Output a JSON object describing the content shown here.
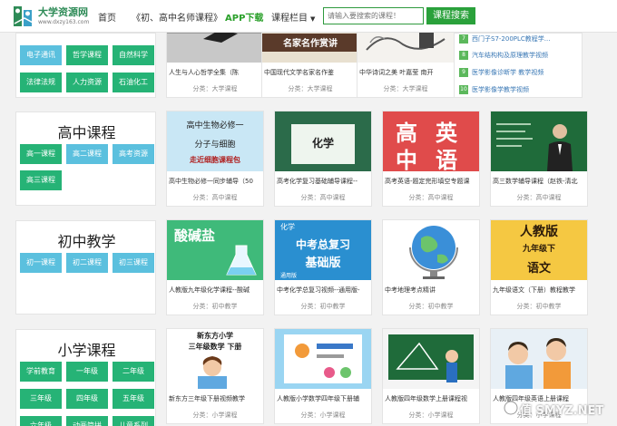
{
  "header": {
    "logo_title": "大学资源网",
    "logo_sub": "www.dxzy163.com",
    "nav": [
      "首页",
      "《初、高中名师课程》",
      "APP下载",
      "课程栏目"
    ],
    "search_placeholder": "请输入要搜索的课程！",
    "search_button": "课程搜索"
  },
  "top_section": {
    "tags": [
      "电子通讯",
      "哲学课程",
      "自然科学",
      "法律法规",
      "人力资源",
      "石油化工"
    ],
    "courses": [
      {
        "title": "人生与人心哲学全集（陈",
        "category": "分类：大学课程"
      },
      {
        "title": "中国现代文学名家名作鉴",
        "category": "分类：大学课程",
        "thumb_text": "名家名作赏讲"
      },
      {
        "title": "中华诗词之美 叶嘉莹 南开",
        "category": "分类：大学课程"
      }
    ]
  },
  "side_list": [
    {
      "num": "7",
      "text": "西门子S7-200PLC教程学..."
    },
    {
      "num": "8",
      "text": "汽车结构构及原理教学视频"
    },
    {
      "num": "9",
      "text": "医学影像诊断学 教学视频"
    },
    {
      "num": "10",
      "text": "医学影像学教学视频"
    }
  ],
  "high_school": {
    "title": "高中课程",
    "tags": [
      "高一课程",
      "高二课程",
      "高考资源",
      "高三课程"
    ],
    "courses": [
      {
        "title": "高中生物必修一同步辅导（50",
        "category": "分类：高中课程",
        "thumb_lines": [
          "高中生物必修一",
          "分子与细胞",
          "走近细胞课程包"
        ]
      },
      {
        "title": "高考化学复习基础辅导课程--",
        "category": "分类：高中课程",
        "thumb_lines": [
          "化学"
        ]
      },
      {
        "title": "高考英语-题定完形填空专题课",
        "category": "分类：高中课程",
        "thumb_lines": [
          "高",
          "英",
          "中",
          "语"
        ]
      },
      {
        "title": "高三数学辅导课程（赵铁-清北",
        "category": "分类：高中课程"
      }
    ]
  },
  "middle_school": {
    "title": "初中教学",
    "tags": [
      "初一课程",
      "初二课程",
      "初三课程"
    ],
    "courses": [
      {
        "title": "人教版九年级化学课程--酸碱",
        "category": "分类：初中教学",
        "thumb_lines": [
          "酸碱盐"
        ]
      },
      {
        "title": "中考化学总复习视频--通用版-",
        "category": "分类：初中教学",
        "thumb_lines": [
          "化学",
          "中考总复习",
          "基础版",
          "通用版"
        ]
      },
      {
        "title": "中考地理考点精讲",
        "category": "分类：初中教学"
      },
      {
        "title": "九年级语文（下册）教程教学",
        "category": "分类：初中教学",
        "thumb_lines": [
          "人教版",
          "九年级下",
          "语文"
        ]
      }
    ]
  },
  "primary_school": {
    "title": "小学课程",
    "tags": [
      "学前教育",
      "一年级",
      "二年级",
      "三年级",
      "四年级",
      "五年级",
      "六年级",
      "动画简拼",
      "儿童系列"
    ],
    "courses": [
      {
        "title": "新东方三年级下册视频教学",
        "category": "分类：小学课程",
        "thumb_lines": [
          "新东方小学",
          "三年级数学 下册"
        ]
      },
      {
        "title": "人教版小学数学四年级下册辅",
        "category": "分类：小学课程"
      },
      {
        "title": "人教版四年级数学上册课程视",
        "category": "分类：小学课程"
      },
      {
        "title": "人教版四年级英语上册课程",
        "category": "分类：小学课程"
      }
    ]
  },
  "watermark": "值 SMYZ.NET"
}
